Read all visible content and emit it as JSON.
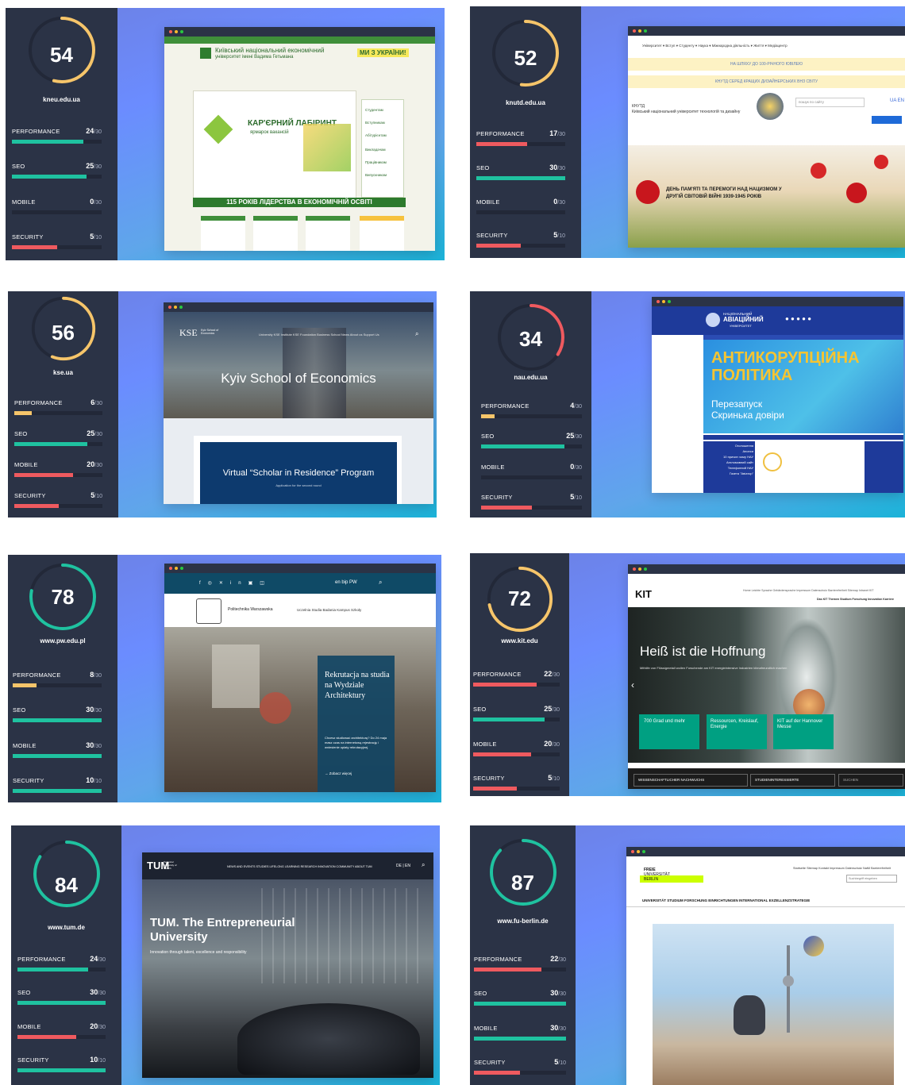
{
  "colors": {
    "panel": "#2b3346",
    "good": "#1fc2a0",
    "medium": "#f6c56a",
    "bad": "#ef5a5f",
    "track": "#222838"
  },
  "cards": [
    {
      "score": "54",
      "domain": "kneu.edu.ua",
      "metrics": [
        {
          "name": "PERFORMANCE",
          "value": "24",
          "max": "/30",
          "fraction": 0.8,
          "status": "good"
        },
        {
          "name": "SEO",
          "value": "25",
          "max": "/30",
          "fraction": 0.83,
          "status": "good"
        },
        {
          "name": "MOBILE",
          "value": "0",
          "max": "/30",
          "fraction": 0,
          "status": "bad"
        },
        {
          "name": "SECURITY",
          "value": "5",
          "max": "/10",
          "fraction": 0.5,
          "status": "bad"
        }
      ],
      "site": {
        "header_line1": "Київський національний економічний",
        "header_line2": "університет імені Вадима Гетьмана",
        "slogan": "МИ З УКРАЇНИ!",
        "banner_title": "КАР'ЄРНИЙ ЛАБІРИНТ",
        "banner_sub": "ярмарок вакансій",
        "banner_foot": "115 РОКІВ ЛІДЕРСТВА В ЕКОНОМІЧНІЙ ОСВІТІ",
        "side_links": [
          "Студентам",
          "Вступникам",
          "Абітурієнтам",
          "Викладачам",
          "Працівникам",
          "Випускникам"
        ]
      }
    },
    {
      "score": "52",
      "domain": "knutd.edu.ua",
      "metrics": [
        {
          "name": "PERFORMANCE",
          "value": "17",
          "max": "/30",
          "fraction": 0.57,
          "status": "bad"
        },
        {
          "name": "SEO",
          "value": "30",
          "max": "/30",
          "fraction": 1,
          "status": "good"
        },
        {
          "name": "MOBILE",
          "value": "0",
          "max": "/30",
          "fraction": 0,
          "status": "bad"
        },
        {
          "name": "SECURITY",
          "value": "5",
          "max": "/10",
          "fraction": 0.5,
          "status": "bad"
        }
      ],
      "site": {
        "nav": "Університет ▾  Вступ ▾  Студенту ▾  Наука ▾  Міжнародна діяльність ▾  Життя ▾  Медіацентр",
        "notice1": "НА ШЛЯХУ ДО 100-РІЧНОГО ЮВІЛЕЮ",
        "notice2": "КНУТД СЕРЕД КРАЩИХ ДИЗАЙНЕРСЬКИХ ВНЗ СВІТУ",
        "uni_short": "КНУТД",
        "uni_full": "Київський національний університет технологій та дизайну",
        "search_placeholder": "пошук по сайту",
        "lang": "UA  EN",
        "banner": "ДЕНЬ ПАМ'ЯТІ ТА ПЕРЕМОГИ НАД НАЦИЗМОМ У ДРУГІЙ СВІТОВІЙ ВІЙНІ 1939-1945 РОКІВ"
      }
    },
    {
      "score": "56",
      "domain": "kse.ua",
      "metrics": [
        {
          "name": "PERFORMANCE",
          "value": "6",
          "max": "/30",
          "fraction": 0.2,
          "status": "medium"
        },
        {
          "name": "SEO",
          "value": "25",
          "max": "/30",
          "fraction": 0.83,
          "status": "good"
        },
        {
          "name": "MOBILE",
          "value": "20",
          "max": "/30",
          "fraction": 0.67,
          "status": "bad"
        },
        {
          "name": "SECURITY",
          "value": "5",
          "max": "/10",
          "fraction": 0.5,
          "status": "bad"
        }
      ],
      "site": {
        "logo": "KSE",
        "logo_sub": "Kyiv School of Economics",
        "nav": "University   KSE Institute   KSE Foundation   Business School   News   About us   Support Us",
        "hero": "Kyiv School of Economics",
        "program": "Virtual “Scholar in Residence” Program",
        "program_sub": "Application for the second round"
      }
    },
    {
      "score": "34",
      "domain": "nau.edu.ua",
      "metrics": [
        {
          "name": "PERFORMANCE",
          "value": "4",
          "max": "/30",
          "fraction": 0.13,
          "status": "medium"
        },
        {
          "name": "SEO",
          "value": "25",
          "max": "/30",
          "fraction": 0.83,
          "status": "good"
        },
        {
          "name": "MOBILE",
          "value": "0",
          "max": "/30",
          "fraction": 0,
          "status": "bad"
        },
        {
          "name": "SECURITY",
          "value": "5",
          "max": "/10",
          "fraction": 0.5,
          "status": "bad"
        }
      ],
      "site": {
        "logo_top": "НАЦІОНАЛЬНИЙ",
        "logo_mid": "АВІАЦІЙНИЙ",
        "logo_bot": "УНІВЕРСИТЕТ",
        "banner1": "АНТИКОРУПЦІЙНА",
        "banner2": "ПОЛІТИКА",
        "banner3": "Перезапуск",
        "banner4": "Скринька довіри",
        "side": [
          "Оголошення",
          "Анонси",
          "10 причин чому НАУ",
          "Англомовний сайт",
          "Телефонний НАУ",
          "Газета \"Авіатор\""
        ]
      }
    },
    {
      "score": "78",
      "domain": "www.pw.edu.pl",
      "metrics": [
        {
          "name": "PERFORMANCE",
          "value": "8",
          "max": "/30",
          "fraction": 0.27,
          "status": "medium"
        },
        {
          "name": "SEO",
          "value": "30",
          "max": "/30",
          "fraction": 1,
          "status": "good"
        },
        {
          "name": "MOBILE",
          "value": "30",
          "max": "/30",
          "fraction": 1,
          "status": "good"
        },
        {
          "name": "SECURITY",
          "value": "10",
          "max": "/10",
          "fraction": 1,
          "status": "good"
        }
      ],
      "site": {
        "top_links": "en   bip   PW   ",
        "name": "Politechnika Warszawska",
        "nav": "Uczelnia     Studia     Badania     Kampus     Szkoły",
        "card_title": "Rekrutacja na studia na Wydziale Architektury",
        "card_text": "Chcesz studiować architekturę? Do 24 maja masz czas na internetową rejestrację i wniesienie opłaty rekrutacyjnej.",
        "card_link": "→  Zobacz więcej"
      }
    },
    {
      "score": "72",
      "domain": "www.kit.edu",
      "metrics": [
        {
          "name": "PERFORMANCE",
          "value": "22",
          "max": "/30",
          "fraction": 0.73,
          "status": "bad"
        },
        {
          "name": "SEO",
          "value": "25",
          "max": "/30",
          "fraction": 0.83,
          "status": "good"
        },
        {
          "name": "MOBILE",
          "value": "20",
          "max": "/30",
          "fraction": 0.67,
          "status": "bad"
        },
        {
          "name": "SECURITY",
          "value": "5",
          "max": "/10",
          "fraction": 0.5,
          "status": "bad"
        }
      ],
      "site": {
        "logo": "KIT",
        "nav_top": "Home  Leichte Sprache  Gebärdensprache  Impressum  Datenschutz  Barrierefreiheit  Sitemap  Intranet  KIT",
        "nav_bottom": "Das KIT   Themen   Studium   Forschung   Innovation   Karriere",
        "hero": "Heiß ist die Hoffnung",
        "hero_sub": "Mithilfe von Flüssigmetall wollen Forschende am KIT energieintensive Industrien klimafreundlich machen",
        "tiles": [
          "700 Grad und mehr",
          "Ressourcen, Kreislauf, Energie",
          "KIT auf der Hannover Messe"
        ],
        "bottom": [
          "WISSENSCHAFTLICHER NACHWUCHS",
          "STUDIENINTERESSIERTE",
          "SUCHEN"
        ]
      }
    },
    {
      "score": "84",
      "domain": "www.tum.de",
      "metrics": [
        {
          "name": "PERFORMANCE",
          "value": "24",
          "max": "/30",
          "fraction": 0.8,
          "status": "good"
        },
        {
          "name": "SEO",
          "value": "30",
          "max": "/30",
          "fraction": 1,
          "status": "good"
        },
        {
          "name": "MOBILE",
          "value": "20",
          "max": "/30",
          "fraction": 0.67,
          "status": "bad"
        },
        {
          "name": "SECURITY",
          "value": "10",
          "max": "/10",
          "fraction": 1,
          "status": "good"
        }
      ],
      "site": {
        "logo": "TUM",
        "logo_sub": "Technical University of Munich",
        "nav": "NEWS AND EVENTS   STUDIES   LIFELONG LEARNING   RESEARCH   INNOVATION   COMMUNITY   ABOUT TUM",
        "lang": "DE | EN",
        "hero1": "TUM. The Entrepreneurial",
        "hero2": "University",
        "hero_sub": "Innovation through talent, excellence and responsibility"
      }
    },
    {
      "score": "87",
      "domain": "www.fu-berlin.de",
      "metrics": [
        {
          "name": "PERFORMANCE",
          "value": "22",
          "max": "/30",
          "fraction": 0.73,
          "status": "bad"
        },
        {
          "name": "SEO",
          "value": "30",
          "max": "/30",
          "fraction": 1,
          "status": "good"
        },
        {
          "name": "MOBILE",
          "value": "30",
          "max": "/30",
          "fraction": 1,
          "status": "good"
        },
        {
          "name": "SECURITY",
          "value": "5",
          "max": "/10",
          "fraction": 0.5,
          "status": "bad"
        }
      ],
      "site": {
        "logo1": "FREIE",
        "logo2": "UNIVERSITÄT",
        "logo3": "BERLIN",
        "top_links": "Startseite   Sitemap   Kontakt   Impressum   Datenschutz   NatM   Barrierefreiheit",
        "nav": "UNIVERSITÄT   STUDIUM   FORSCHUNG   EINRICHTUNGEN   INTERNATIONAL   EXZELLENZSTRATEGIE",
        "search_placeholder": "Suchbegriff eingeben"
      }
    }
  ]
}
